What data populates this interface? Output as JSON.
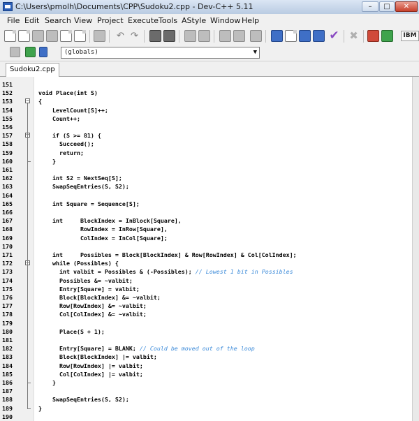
{
  "window": {
    "title": "C:\\Users\\pmolh\\Documents\\CPP\\Sudoku2.cpp - Dev-C++ 5.11",
    "buttons": {
      "minimize": "–",
      "maximize": "□",
      "close": "✕"
    }
  },
  "menu": [
    "File",
    "Edit",
    "Search",
    "View",
    "Project",
    "Execute",
    "Tools",
    "AStyle",
    "Window",
    "Help"
  ],
  "toolbar": {
    "icons": [
      "new-file-icon",
      "open-icon",
      "save-icon",
      "save-all-icon",
      "close-icon",
      "close-all-icon",
      "print-icon",
      "undo-icon",
      "redo-icon",
      "find-icon",
      "replace-icon",
      "find-next-icon",
      "goto-line-icon",
      "indent-icon",
      "unindent-icon",
      "toggle-comment-icon",
      "bookmark-icon",
      "compile-icon",
      "run-icon",
      "compile-run-icon",
      "rebuild-icon",
      "check-icon",
      "stop-icon",
      "chart-icon",
      "debug-icon"
    ],
    "ibm_label": "IBM"
  },
  "scope_selector": {
    "value": "(globals)"
  },
  "tab": {
    "label": "Sudoku2.cpp"
  },
  "editor": {
    "lines": [
      {
        "n": "151",
        "text": ""
      },
      {
        "n": "152",
        "text": "void Place(int S)"
      },
      {
        "n": "153",
        "text": "{",
        "fold": "−"
      },
      {
        "n": "154",
        "text": "    LevelCount[S]++;"
      },
      {
        "n": "155",
        "text": "    Count++;"
      },
      {
        "n": "156",
        "text": ""
      },
      {
        "n": "157",
        "text": "    if (S >= 81) {",
        "fold": "−"
      },
      {
        "n": "158",
        "text": "      Succeed();"
      },
      {
        "n": "159",
        "text": "      return;"
      },
      {
        "n": "160",
        "text": "    }"
      },
      {
        "n": "161",
        "text": ""
      },
      {
        "n": "162",
        "text": "    int S2 = NextSeq[S];"
      },
      {
        "n": "163",
        "text": "    SwapSeqEntries(S, S2);"
      },
      {
        "n": "164",
        "text": ""
      },
      {
        "n": "165",
        "text": "    int Square = Sequence[S];"
      },
      {
        "n": "166",
        "text": ""
      },
      {
        "n": "167",
        "text": "    int     BlockIndex = InBlock[Square],"
      },
      {
        "n": "168",
        "text": "            RowIndex = InRow[Square],"
      },
      {
        "n": "169",
        "text": "            ColIndex = InCol[Square];"
      },
      {
        "n": "170",
        "text": ""
      },
      {
        "n": "171",
        "text": "    int     Possibles = Block[BlockIndex] & Row[RowIndex] & Col[ColIndex];"
      },
      {
        "n": "172",
        "text": "    while (Possibles) {",
        "fold": "−"
      },
      {
        "n": "173",
        "text": "      int valbit = Possibles & (-Possibles); ",
        "comment": "// Lowest 1 bit in Possibles"
      },
      {
        "n": "174",
        "text": "      Possibles &= ~valbit;"
      },
      {
        "n": "175",
        "text": "      Entry[Square] = valbit;"
      },
      {
        "n": "176",
        "text": "      Block[BlockIndex] &= ~valbit;"
      },
      {
        "n": "177",
        "text": "      Row[RowIndex] &= ~valbit;"
      },
      {
        "n": "178",
        "text": "      Col[ColIndex] &= ~valbit;"
      },
      {
        "n": "179",
        "text": ""
      },
      {
        "n": "180",
        "text": "      Place(S + 1);"
      },
      {
        "n": "181",
        "text": ""
      },
      {
        "n": "182",
        "text": "      Entry[Square] = BLANK; ",
        "comment": "// Could be moved out of the loop"
      },
      {
        "n": "183",
        "text": "      Block[BlockIndex] |= valbit;"
      },
      {
        "n": "184",
        "text": "      Row[RowIndex] |= valbit;"
      },
      {
        "n": "185",
        "text": "      Col[ColIndex] |= valbit;"
      },
      {
        "n": "186",
        "text": "    }"
      },
      {
        "n": "187",
        "text": ""
      },
      {
        "n": "188",
        "text": "    SwapSeqEntries(S, S2);"
      },
      {
        "n": "189",
        "text": "}"
      },
      {
        "n": "190",
        "text": ""
      }
    ]
  }
}
